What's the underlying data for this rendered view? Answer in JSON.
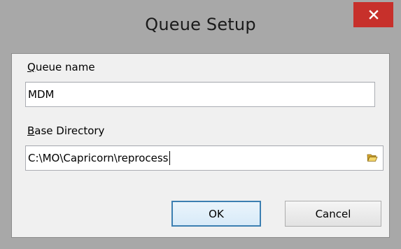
{
  "window": {
    "title": "Queue Setup"
  },
  "form": {
    "queue_name": {
      "label_mnemonic": "Q",
      "label_rest": "ueue name",
      "value": "MDM"
    },
    "base_directory": {
      "label_mnemonic": "B",
      "label_rest": "ase Directory",
      "value": "C:\\MO\\Capricorn\\reprocess",
      "browse_icon": "folder-icon"
    }
  },
  "buttons": {
    "ok_label": "OK",
    "cancel_label": "Cancel"
  },
  "colors": {
    "close_button": "#c7302b",
    "frame": "#a8a8a8",
    "client_background": "#f0f0f0",
    "default_button_border": "#3c7fb1",
    "folder_icon": "#e8c24a"
  },
  "icons": {
    "close": "close-icon",
    "browse": "folder-icon"
  }
}
